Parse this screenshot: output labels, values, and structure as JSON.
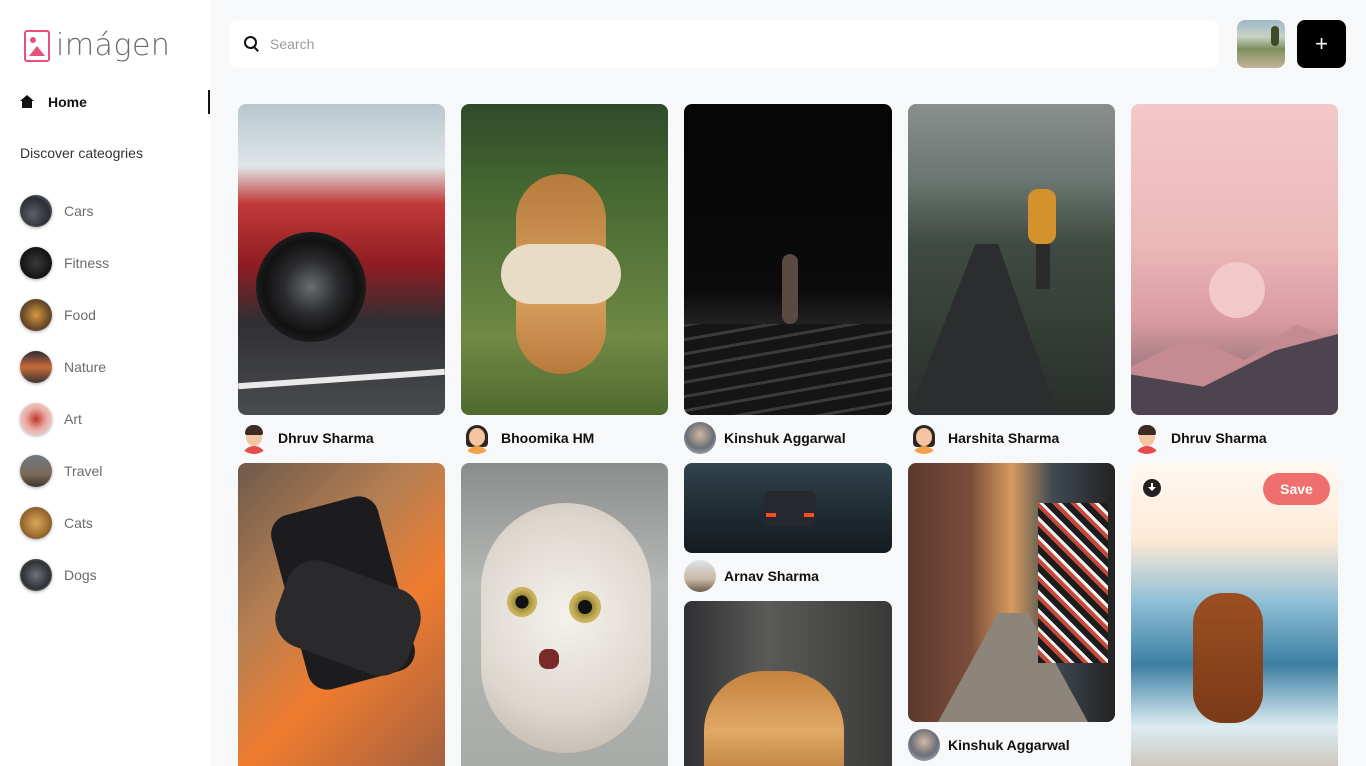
{
  "app": {
    "name": "imágen"
  },
  "nav": {
    "home_label": "Home",
    "discover_heading": "Discover cateogries"
  },
  "categories": [
    {
      "label": "Cars"
    },
    {
      "label": "Fitness"
    },
    {
      "label": "Food"
    },
    {
      "label": "Nature"
    },
    {
      "label": "Art"
    },
    {
      "label": "Travel"
    },
    {
      "label": "Cats"
    },
    {
      "label": "Dogs"
    }
  ],
  "search": {
    "placeholder": "Search",
    "value": ""
  },
  "header": {
    "add_label": "+"
  },
  "pins": [
    {
      "author": "Dhruv Sharma",
      "subject": "red sports car"
    },
    {
      "author": "Bhoomika HM",
      "subject": "dog carrying toy"
    },
    {
      "author": "Kinshuk Aggarwal",
      "subject": "runner at night"
    },
    {
      "author": "Harshita Sharma",
      "subject": "walker on mountain road"
    },
    {
      "author": "Dhruv Sharma",
      "subject": "pink mountains"
    },
    {
      "author": "",
      "subject": "gym gloves"
    },
    {
      "author": "",
      "subject": "surprised kitten"
    },
    {
      "author": "Arnav Sharma",
      "subject": "car on wet street"
    },
    {
      "author": "",
      "subject": "tabby cat"
    },
    {
      "author": "Kinshuk Aggarwal",
      "subject": "graffiti alley"
    },
    {
      "author": "",
      "subject": "dog on beach"
    }
  ],
  "hover_pin": {
    "save_label": "Save"
  }
}
